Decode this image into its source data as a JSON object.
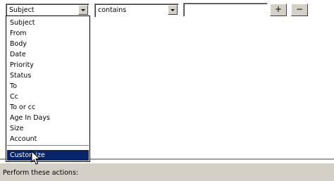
{
  "condition": {
    "field_value": "Subject",
    "operator_value": "contains",
    "text_value": "",
    "add_label": "+",
    "remove_label": "−"
  },
  "dropdown": {
    "items": [
      "Subject",
      "From",
      "Body",
      "Date",
      "Priority",
      "Status",
      "To",
      "Cc",
      "To or cc",
      "Age In Days",
      "Size",
      "Account"
    ],
    "selected_label": "Customize"
  },
  "footer": {
    "actions_label": "Perform these actions:"
  },
  "icons": {
    "dropdown": "chevron-down-icon",
    "cursor": "mouse-pointer-icon"
  },
  "colors": {
    "selection": "#0a246a",
    "window_bg": "#d4d0c8"
  }
}
